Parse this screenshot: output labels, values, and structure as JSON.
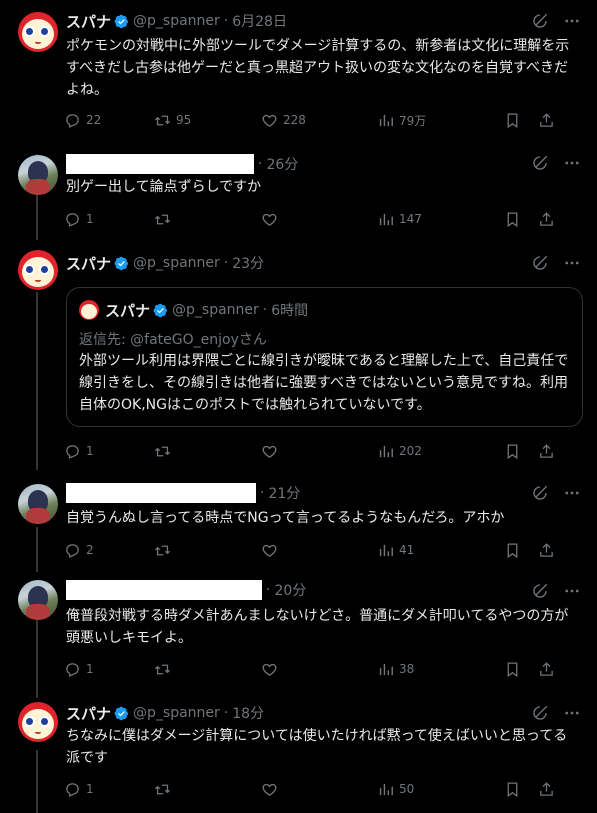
{
  "posts": [
    {
      "author": "スパナ",
      "handle": "@p_spanner",
      "time": "6月28日",
      "text": "ポケモンの対戦中に外部ツールでダメージ計算するの、新参者は文化に理解を示すべきだし古参は他ゲーだと真っ黒超アウト扱いの変な文化なのを自覚すべきだよね。",
      "replies": "22",
      "reposts": "95",
      "likes": "228",
      "views": "79万"
    },
    {
      "author": "",
      "handle": "",
      "time": "26分",
      "text": "別ゲー出して論点ずらしですか",
      "replies": "1",
      "reposts": "",
      "likes": "",
      "views": "147"
    },
    {
      "author": "スパナ",
      "handle": "@p_spanner",
      "time": "23分",
      "text": "",
      "replies": "1",
      "reposts": "",
      "likes": "",
      "views": "202",
      "quote": {
        "author": "スパナ",
        "handle": "@p_spanner",
        "time": "6時間",
        "reply_to_label": "返信先: ",
        "reply_to": "@fateGO_enjoyさん",
        "text": "外部ツール利用は界隈ごとに線引きが曖昧であると理解した上で、自己責任で線引きをし、その線引きは他者に強要すべきではないという意見ですね。利用自体のOK,NGはこのポストでは触れられていないです。"
      }
    },
    {
      "author": "",
      "handle": "",
      "time": "21分",
      "text": "自覚うんぬし言ってる時点でNGって言ってるようなもんだろ。アホか",
      "replies": "2",
      "reposts": "",
      "likes": "",
      "views": "41"
    },
    {
      "author": "",
      "handle": "",
      "time": "20分",
      "text": "俺普段対戦する時ダメ計あんましないけどさ。普通にダメ計叩いてるやつの方が頭悪いしキモイよ。",
      "replies": "1",
      "reposts": "",
      "likes": "",
      "views": "38"
    },
    {
      "author": "スパナ",
      "handle": "@p_spanner",
      "time": "18分",
      "text": "ちなみに僕はダメージ計算については使いたければ黙って使えばいいと思ってる派です",
      "replies": "1",
      "reposts": "",
      "likes": "",
      "views": "50"
    }
  ],
  "separator": "·",
  "icons": {
    "verified": "verified-badge-icon",
    "grok": "grok-icon",
    "more": "more-icon",
    "reply": "reply-icon",
    "repost": "repost-icon",
    "like": "like-icon",
    "views": "views-icon",
    "bookmark": "bookmark-icon",
    "share": "share-icon"
  },
  "colors": {
    "background": "#000000",
    "text": "#e7e9ea",
    "muted": "#71767b",
    "verified": "#1d9bf0",
    "border": "#2f3336"
  }
}
